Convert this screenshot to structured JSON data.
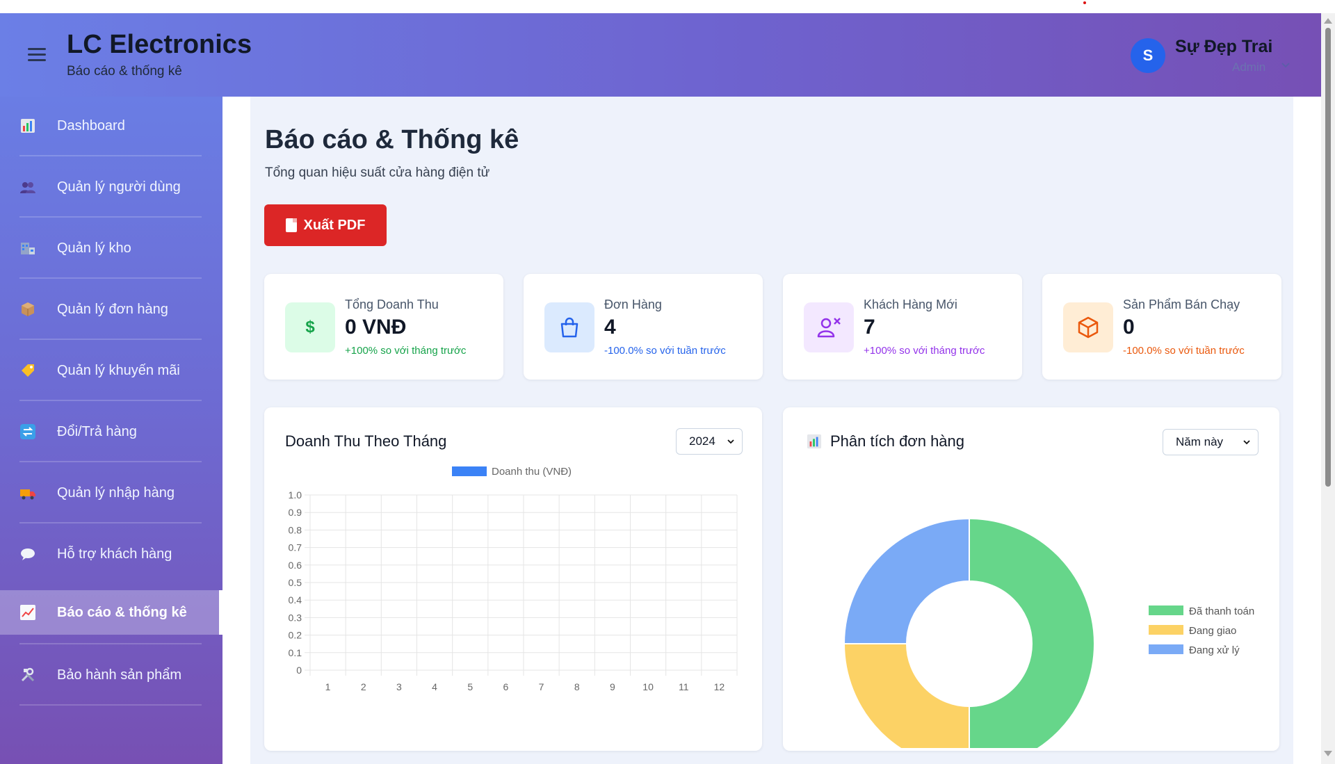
{
  "header": {
    "brand_title": "LC Electronics",
    "brand_subtitle": "Báo cáo & thống kê",
    "user_initial": "S",
    "user_name": "Sự Đẹp Trai",
    "user_role": "Admin"
  },
  "sidebar": {
    "items": [
      {
        "label": "Dashboard",
        "icon": "bar-chart-icon"
      },
      {
        "label": "Quản lý người dùng",
        "icon": "users-icon"
      },
      {
        "label": "Quản lý kho",
        "icon": "warehouse-icon"
      },
      {
        "label": "Quản lý đơn hàng",
        "icon": "package-icon"
      },
      {
        "label": "Quản lý khuyến mãi",
        "icon": "tag-icon"
      },
      {
        "label": "Đổi/Trả hàng",
        "icon": "exchange-icon"
      },
      {
        "label": "Quản lý nhập hàng",
        "icon": "truck-icon"
      },
      {
        "label": "Hỗ trợ khách hàng",
        "icon": "chat-bubble-icon"
      },
      {
        "label": "Báo cáo & thống kê",
        "icon": "trend-chart-icon",
        "active": true
      },
      {
        "label": "Bảo hành sản phẩm",
        "icon": "tools-icon"
      }
    ]
  },
  "page": {
    "title": "Báo cáo & Thống kê",
    "subtitle": "Tổng quan hiệu suất cửa hàng điện tử",
    "export_button": "Xuất PDF"
  },
  "stats": [
    {
      "label": "Tổng Doanh Thu",
      "value": "0 VNĐ",
      "change": "+100% so với tháng trước",
      "icon": "dollar-icon",
      "accent": "#16a34a",
      "icon_bg": "#dcfce7"
    },
    {
      "label": "Đơn Hàng",
      "value": "4",
      "change": "-100.0% so với tuần trước",
      "icon": "shopping-bag-icon",
      "accent": "#2563eb",
      "icon_bg": "#dbeafe"
    },
    {
      "label": "Khách Hàng Mới",
      "value": "7",
      "change": "+100% so với tháng trước",
      "icon": "user-plus-icon",
      "accent": "#9333ea",
      "icon_bg": "#f3e8ff"
    },
    {
      "label": "Sản Phẩm Bán Chạy",
      "value": "0",
      "change": "-100.0% so với tuần trước",
      "icon": "box-icon",
      "accent": "#ea580c",
      "icon_bg": "#ffedd5"
    }
  ],
  "revenue_chart": {
    "title": "Doanh Thu Theo Tháng",
    "year_selected": "2024"
  },
  "orders_chart": {
    "title": "Phân tích đơn hàng",
    "period_selected": "Năm này"
  },
  "chart_data": [
    {
      "type": "bar",
      "title": "Doanh Thu Theo Tháng",
      "categories": [
        "1",
        "2",
        "3",
        "4",
        "5",
        "6",
        "7",
        "8",
        "9",
        "10",
        "11",
        "12"
      ],
      "series": [
        {
          "name": "Doanh thu (VNĐ)",
          "values": [
            0,
            0,
            0,
            0,
            0,
            0,
            0,
            0,
            0,
            0,
            0,
            0
          ],
          "color": "#3b82f6"
        }
      ],
      "yticks": [
        "0",
        "0.1",
        "0.2",
        "0.3",
        "0.4",
        "0.5",
        "0.6",
        "0.7",
        "0.8",
        "0.9",
        "1.0"
      ],
      "ylim": [
        0,
        1
      ],
      "grid": true,
      "legend": "top"
    },
    {
      "type": "pie",
      "title": "Phân tích đơn hàng",
      "labels": [
        "Đã thanh toán",
        "Đang giao",
        "Đang xử lý"
      ],
      "values": [
        2,
        1,
        1
      ],
      "colors": [
        "#66d68a",
        "#fcd265",
        "#7aaaf6"
      ],
      "legend": "right"
    }
  ]
}
